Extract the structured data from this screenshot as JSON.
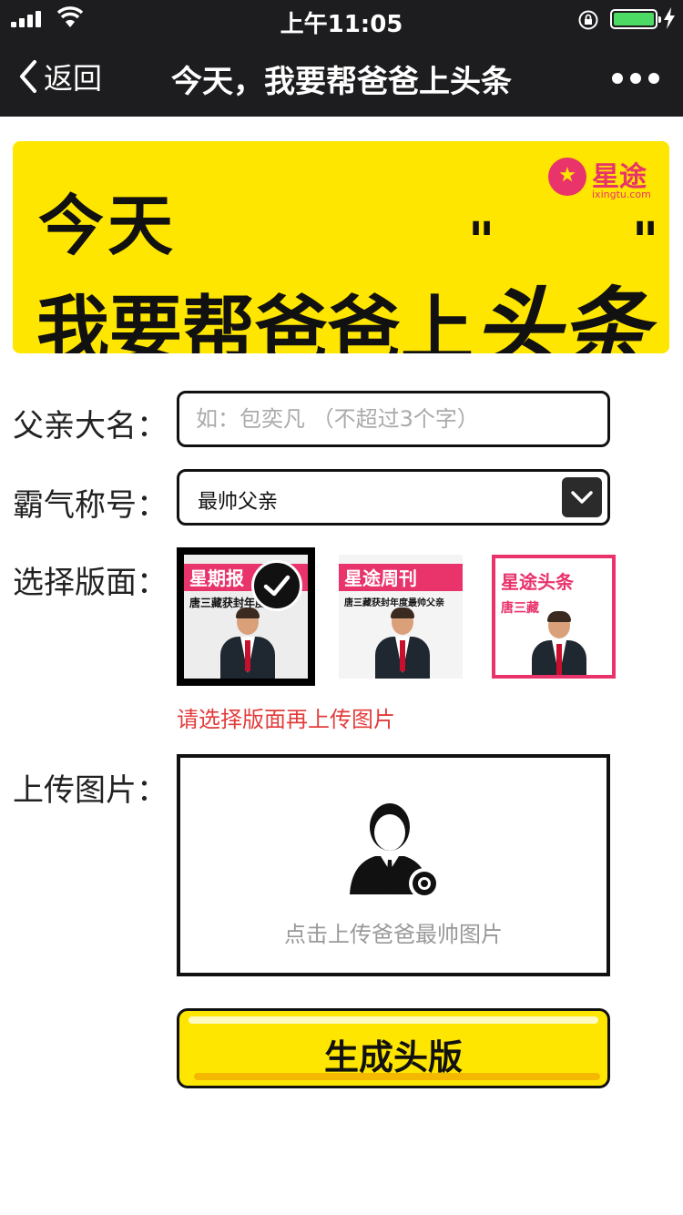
{
  "status_bar": {
    "time": "上午11:05"
  },
  "nav": {
    "back_label": "返回",
    "title": "今天，我要帮爸爸上头条"
  },
  "banner": {
    "line1": "今天",
    "line2_prefix": "我要帮爸爸上",
    "line2_highlight": "头条",
    "brand_name": "星途",
    "brand_url": "ixingtu.com"
  },
  "form": {
    "father_name": {
      "label": "父亲大名：",
      "value": "",
      "placeholder": "如：包奕凡 （不超过3个字）"
    },
    "title": {
      "label": "霸气称号：",
      "selected": "最帅父亲"
    },
    "layout": {
      "label": "选择版面：",
      "selected_index": 0,
      "options": [
        {
          "masthead": "星期报",
          "headline": "唐三藏获封年度",
          "bg": "#e8336b"
        },
        {
          "masthead": "星途周刊",
          "headline": "唐三藏获封年度最帅父亲",
          "bg": "#e8336b"
        },
        {
          "masthead": "星途头条",
          "headline": "唐三藏",
          "bg": "#e8336b"
        }
      ],
      "warning": "请选择版面再上传图片"
    },
    "upload": {
      "label": "上传图片：",
      "hint": "点击上传爸爸最帅图片"
    },
    "submit_label": "生成头版"
  },
  "colors": {
    "accent_yellow": "#ffe600",
    "brand_pink": "#e8336b",
    "warning_red": "#e33c3c",
    "bar_dark": "#1d1d1f"
  }
}
